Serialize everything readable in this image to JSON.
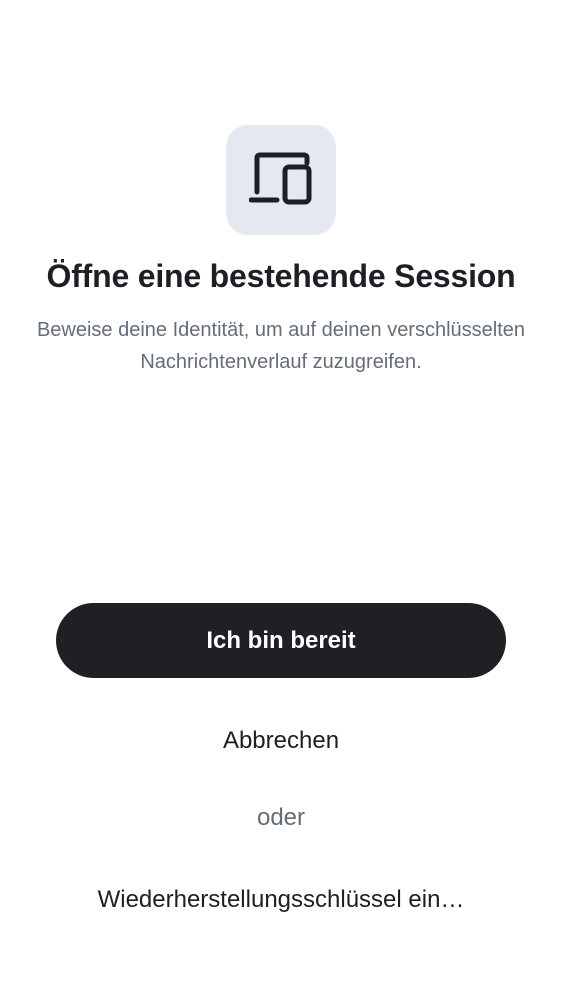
{
  "header_icon": {
    "name": "devices-icon",
    "tile_color": "#e3e8f1"
  },
  "title": "Öffne eine bestehende Session",
  "subtitle": "Beweise deine Identität, um auf deinen verschlüsselten Nachrichtenverlauf zuzugreifen.",
  "actions": {
    "primary_label": "Ich bin bereit",
    "cancel_label": "Abbrechen",
    "separator": "oder",
    "recovery_label": "Wiederherstellungsschlüssel ein…"
  },
  "colors": {
    "primary_button": "#1f2024",
    "primary_text": "#1d1f24",
    "secondary_text": "#656d77",
    "background": "#ffffff"
  }
}
